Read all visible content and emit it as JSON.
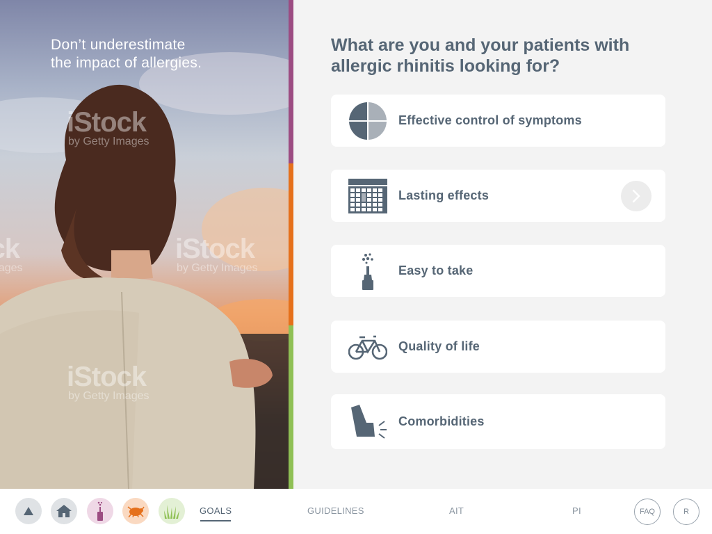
{
  "hero": {
    "title_line1": "Don’t underestimate",
    "title_line2": "the impact of allergies.",
    "watermark_brand": "iStock",
    "watermark_sub": "by Getty Images"
  },
  "main": {
    "question_line1": "What are you and your patients with",
    "question_line2": "allergic rhinitis looking for?",
    "cards": [
      {
        "label": "Effective control of symptoms",
        "icon": "pie-chart-icon"
      },
      {
        "label": "Lasting effects",
        "icon": "calendar-icon"
      },
      {
        "label": "Easy to take",
        "icon": "nasal-spray-icon"
      },
      {
        "label": "Quality of life",
        "icon": "bicycle-icon"
      },
      {
        "label": "Comorbidities",
        "icon": "inhaler-icon"
      }
    ]
  },
  "bottom_nav": {
    "tabs": [
      {
        "label": "GOALS",
        "active": true
      },
      {
        "label": "GUIDELINES",
        "active": false
      },
      {
        "label": "AIT",
        "active": false
      },
      {
        "label": "PI",
        "active": false
      }
    ],
    "faq_label": "FAQ",
    "r_label": "R",
    "circle_icons": [
      "triangle-up-icon",
      "home-icon",
      "spray-bottle-icon",
      "dust-mite-icon",
      "grass-icon"
    ]
  },
  "colors": {
    "text": "#566675",
    "stripe_purple": "#9c4c82",
    "stripe_orange": "#e5701b",
    "stripe_green": "#8fc055"
  }
}
